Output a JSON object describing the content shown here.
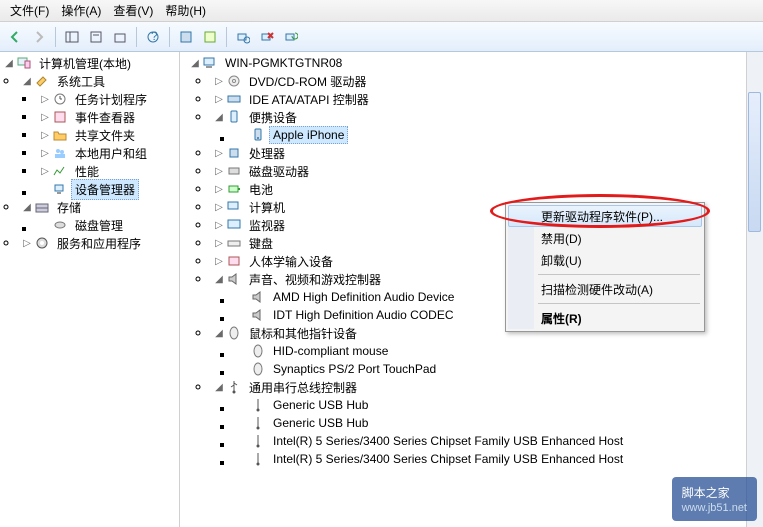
{
  "menu": {
    "file": "文件(F)",
    "action": "操作(A)",
    "view": "查看(V)",
    "help": "帮助(H)"
  },
  "left_tree": {
    "root": "计算机管理(本地)",
    "system_tools": "系统工具",
    "task_scheduler": "任务计划程序",
    "event_viewer": "事件查看器",
    "shared_folders": "共享文件夹",
    "local_users": "本地用户和组",
    "performance": "性能",
    "device_manager": "设备管理器",
    "storage": "存储",
    "disk_mgmt": "磁盘管理",
    "services_apps": "服务和应用程序"
  },
  "right_tree": {
    "root": "WIN-PGMKTGTNR08",
    "dvd": "DVD/CD-ROM 驱动器",
    "ide": "IDE ATA/ATAPI 控制器",
    "portable": "便携设备",
    "apple": "Apple iPhone",
    "cpu": "处理器",
    "diskdrv": "磁盘驱动器",
    "battery": "电池",
    "computer": "计算机",
    "monitor": "监视器",
    "keyboard": "键盘",
    "hid": "人体学输入设备",
    "sound": "声音、视频和游戏控制器",
    "amd_audio": "AMD High Definition Audio Device",
    "idt_audio": "IDT High Definition Audio CODEC",
    "mouse": "鼠标和其他指针设备",
    "hid_mouse": "HID-compliant mouse",
    "synaptics": "Synaptics PS/2 Port TouchPad",
    "usb": "通用串行总线控制器",
    "usb_hub1": "Generic USB Hub",
    "usb_hub2": "Generic USB Hub",
    "intel1": "Intel(R) 5 Series/3400 Series Chipset Family USB Enhanced Host",
    "intel2": "Intel(R) 5 Series/3400 Series Chipset Family USB Enhanced Host"
  },
  "context_menu": {
    "update_driver": "更新驱动程序软件(P)...",
    "disable": "禁用(D)",
    "uninstall": "卸载(U)",
    "scan": "扫描检测硬件改动(A)",
    "properties": "属性(R)"
  },
  "watermark": {
    "site": "脚本之家",
    "url": "www.jb51.net"
  }
}
